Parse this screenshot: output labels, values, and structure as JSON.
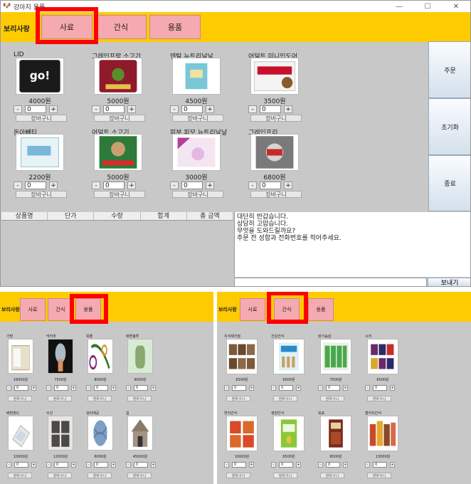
{
  "window_title": "강아지 용품",
  "brand": "보리사랑",
  "main": {
    "tabs": [
      "사료",
      "간식",
      "용품"
    ],
    "items": [
      {
        "name": "LID",
        "price": "4000원",
        "qty": "0",
        "cart": "장바구니",
        "icon": "dog-food-bag-black"
      },
      {
        "name": "그레인프랑 소고기",
        "price": "5000원",
        "qty": "0",
        "cart": "장바구니",
        "icon": "dog-food-bag-red"
      },
      {
        "name": "덴탈 뉴트리날날",
        "price": "4500원",
        "qty": "0",
        "cart": "장바구니",
        "icon": "dental-food-box"
      },
      {
        "name": "어덜트 미니인도어",
        "price": "3500원",
        "qty": "0",
        "cart": "장바구니",
        "icon": "royal-canin-bag"
      },
      {
        "name": "돈아뻬티",
        "price": "2200원",
        "qty": "0",
        "cart": "장바구니",
        "icon": "white-food-bag"
      },
      {
        "name": "어덜트 소고기",
        "price": "5000원",
        "qty": "0",
        "cart": "장바구니",
        "icon": "dog-food-bag-green"
      },
      {
        "name": "피부,피모 뉴트리날날",
        "price": "3000원",
        "qty": "0",
        "cart": "장바구니",
        "icon": "skin-care-food-bag"
      },
      {
        "name": "그레인프리",
        "price": "6800원",
        "qty": "0",
        "cart": "장바구니",
        "icon": "grain-free-bag"
      }
    ],
    "side_buttons": [
      "주문",
      "초기화",
      "종료"
    ],
    "table_headers": [
      "상품명",
      "단가",
      "수량",
      "합계",
      "총 금액"
    ],
    "chat_lines": [
      "대단히 반갑습니다.",
      "상당히 고맙습니다.",
      "무엇을 도와드릴까요?",
      "주문 전 성함과 전화번호를 적어주세요."
    ],
    "send_label": "보내기"
  },
  "goods": {
    "tabs": [
      "사료",
      "간식",
      "용품"
    ],
    "items": [
      {
        "name": "가방",
        "price": "18000원",
        "qty": "0",
        "cart": "장바구니",
        "icon": "pet-carrier-bag"
      },
      {
        "name": "넥카라",
        "price": "7500원",
        "qty": "0",
        "cart": "장바구니",
        "icon": "neck-collar"
      },
      {
        "name": "목줄",
        "price": "8000원",
        "qty": "0",
        "cart": "장바구니",
        "icon": "leash"
      },
      {
        "name": "배변봉투",
        "price": "9000원",
        "qty": "0",
        "cart": "장바구니",
        "icon": "poop-bags"
      },
      {
        "name": "배변판드",
        "price": "10000원",
        "qty": "0",
        "cart": "장바구니",
        "icon": "potty-tray"
      },
      {
        "name": "수건",
        "price": "12000원",
        "qty": "0",
        "cart": "장바구니",
        "icon": "towels"
      },
      {
        "name": "실타래공",
        "price": "6000원",
        "qty": "0",
        "cart": "장바구니",
        "icon": "rope-ball"
      },
      {
        "name": "집",
        "price": "45000원",
        "qty": "0",
        "cart": "장바구니",
        "icon": "dog-house"
      }
    ]
  },
  "snacks": {
    "tabs": [
      "사료",
      "간식",
      "용품"
    ],
    "items": [
      {
        "name": "치석제거껌",
        "price": "6500원",
        "qty": "0",
        "cart": "장바구니",
        "icon": "dental-chews"
      },
      {
        "name": "건강간식",
        "price": "6000원",
        "qty": "0",
        "cart": "장바구니",
        "icon": "health-snack"
      },
      {
        "name": "닭가슴살",
        "price": "7500원",
        "qty": "0",
        "cart": "장바구니",
        "icon": "chicken-breast"
      },
      {
        "name": "시저",
        "price": "6500원",
        "qty": "0",
        "cart": "장바구니",
        "icon": "cesar-cans"
      },
      {
        "name": "연어간식",
        "price": "10000원",
        "qty": "0",
        "cart": "장바구니",
        "icon": "salmon-snack"
      },
      {
        "name": "영양간식",
        "price": "6500원",
        "qty": "0",
        "cart": "장바구니",
        "icon": "nutrition-snack"
      },
      {
        "name": "육포",
        "price": "8000원",
        "qty": "0",
        "cart": "장바구니",
        "icon": "jerky"
      },
      {
        "name": "캘커치간식",
        "price": "13000원",
        "qty": "0",
        "cart": "장바구니",
        "icon": "snack-assortment"
      }
    ]
  },
  "colors": {
    "header": "#fecb00",
    "tab": "#f5a9b0",
    "highlight": "#ff0000",
    "panel": "#c8c8c8"
  }
}
